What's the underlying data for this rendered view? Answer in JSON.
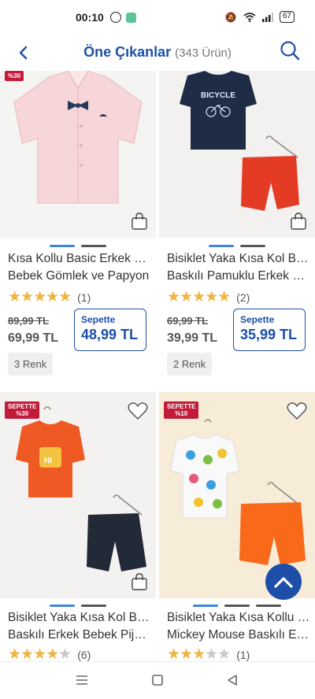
{
  "status_bar": {
    "time": "00:10",
    "battery": "67"
  },
  "header": {
    "title": "Öne Çıkanlar",
    "count": "(343 Ürün)"
  },
  "products": [
    {
      "name": "Kısa Kollu Basic Erkek Bebek Gömlek ve Papyon",
      "badge": "%30",
      "rating": 5,
      "reviews": "(1)",
      "old_price": "89,99 TL",
      "price": "69,99 TL",
      "basket_label": "Sepette",
      "basket_price": "48,99 TL",
      "colors": "3 Renk"
    },
    {
      "name": "Bisiklet Yaka Kısa Kol Baskılı Pamuklu Erkek Bebek Takım",
      "badge": "",
      "rating": 5,
      "reviews": "(2)",
      "old_price": "69,99 TL",
      "price": "39,99 TL",
      "basket_label": "Sepette",
      "basket_price": "35,99 TL",
      "colors": "2 Renk"
    },
    {
      "name": "Bisiklet Yaka Kısa Kol Baskılı Erkek Bebek Pijama Takımı",
      "badge_top": "SEPETTE",
      "badge": "%30",
      "rating": 4,
      "reviews": "(6)"
    },
    {
      "name": "Bisiklet Yaka Kısa Kollu Mickey Mouse Baskılı Erkek Bebek Takım",
      "badge_top": "SEPETTE",
      "badge": "%10",
      "rating": 3,
      "reviews": "(1)"
    }
  ],
  "colors": {
    "brand": "#1d4fa8",
    "badge": "#c21b3a",
    "star": "#f0b440",
    "dot_active": "#3e84e0"
  },
  "icons": [
    "back-icon",
    "search-icon",
    "shopping-bag-icon",
    "heart-icon",
    "chevron-up-icon",
    "menu-icon",
    "home-icon",
    "back-nav-icon"
  ]
}
